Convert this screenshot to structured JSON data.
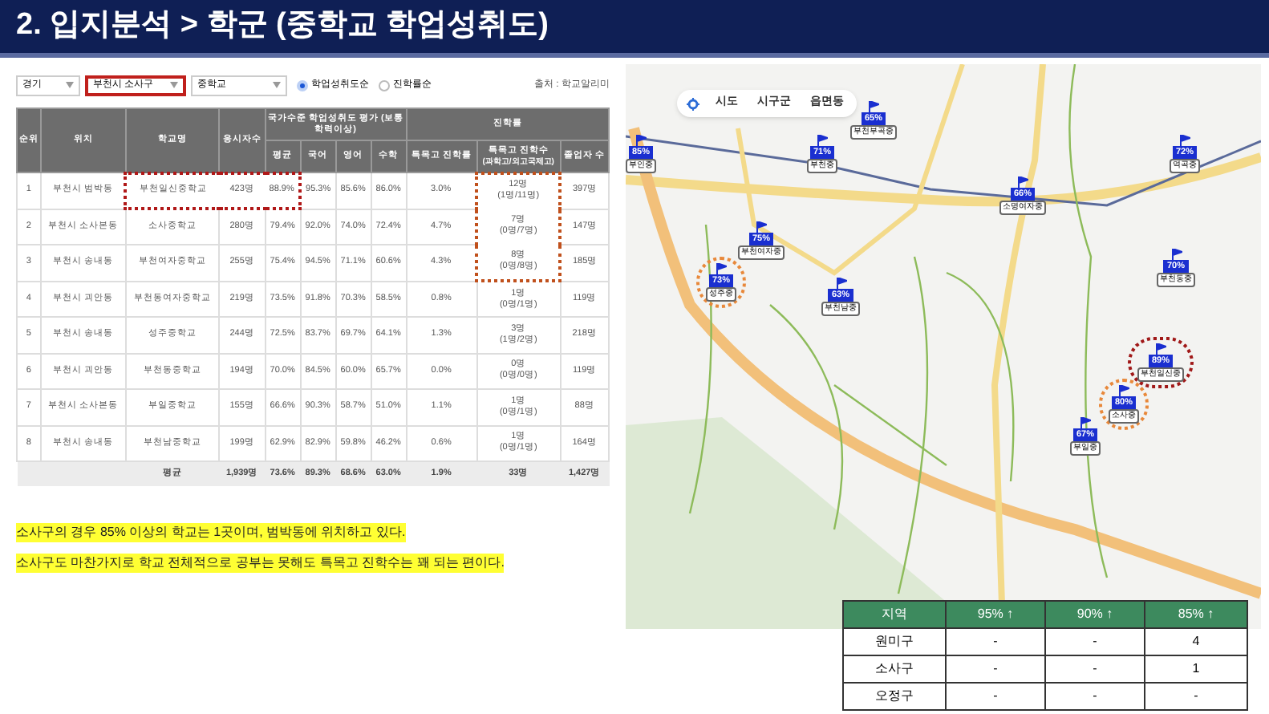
{
  "header": {
    "title": "2. 입지분석 > 학군 (중학교 학업성취도)"
  },
  "filters": {
    "selects": [
      {
        "value": "경기",
        "highlighted": false
      },
      {
        "value": "부천시 소사구",
        "highlighted": true
      },
      {
        "value": "중학교",
        "highlighted": false
      }
    ],
    "sort_options": [
      {
        "label": "학업성취도순",
        "selected": true
      },
      {
        "label": "진학률순",
        "selected": false
      }
    ],
    "source": "출처 : 학교알리미"
  },
  "table": {
    "columns": [
      "순위",
      "위치",
      "학교명",
      "응시자수"
    ],
    "group_1": {
      "title": "국가수준 학업성취도 평가 (보통학력이상)",
      "columns": [
        "평균",
        "국어",
        "영어",
        "수학"
      ]
    },
    "group_2": {
      "title": "진학률",
      "columns": [
        {
          "title": "특목고 진학률"
        },
        {
          "title": "특목고 진학수",
          "subtitle": "(과학고/외고국제고)"
        },
        {
          "title": "졸업자 수"
        }
      ]
    },
    "rows": [
      {
        "rank": "1",
        "location": "부천시 범박동",
        "school": "부천일신중학교",
        "takers": "423명",
        "avg": "88.9%",
        "korean": "95.3%",
        "english": "85.6%",
        "math": "86.0%",
        "rate": "3.0%",
        "count": "12명",
        "count_detail": "(1명/11명)",
        "graduates": "397명",
        "school_highlighted": true,
        "count_highlighted": true
      },
      {
        "rank": "2",
        "location": "부천시 소사본동",
        "school": "소사중학교",
        "takers": "280명",
        "avg": "79.4%",
        "korean": "92.0%",
        "english": "74.0%",
        "math": "72.4%",
        "rate": "4.7%",
        "count": "7명",
        "count_detail": "(0명/7명)",
        "graduates": "147명",
        "school_highlighted": false,
        "count_highlighted": true
      },
      {
        "rank": "3",
        "location": "부천시 송내동",
        "school": "부천여자중학교",
        "takers": "255명",
        "avg": "75.4%",
        "korean": "94.5%",
        "english": "71.1%",
        "math": "60.6%",
        "rate": "4.3%",
        "count": "8명",
        "count_detail": "(0명/8명)",
        "graduates": "185명",
        "school_highlighted": false,
        "count_highlighted": true
      },
      {
        "rank": "4",
        "location": "부천시 괴안동",
        "school": "부천동여자중학교",
        "takers": "219명",
        "avg": "73.5%",
        "korean": "91.8%",
        "english": "70.3%",
        "math": "58.5%",
        "rate": "0.8%",
        "count": "1명",
        "count_detail": "(0명/1명)",
        "graduates": "119명",
        "school_highlighted": false,
        "count_highlighted": false
      },
      {
        "rank": "5",
        "location": "부천시 송내동",
        "school": "성주중학교",
        "takers": "244명",
        "avg": "72.5%",
        "korean": "83.7%",
        "english": "69.7%",
        "math": "64.1%",
        "rate": "1.3%",
        "count": "3명",
        "count_detail": "(1명/2명)",
        "graduates": "218명",
        "school_highlighted": false,
        "count_highlighted": false
      },
      {
        "rank": "6",
        "location": "부천시 괴안동",
        "school": "부천동중학교",
        "takers": "194명",
        "avg": "70.0%",
        "korean": "84.5%",
        "english": "60.0%",
        "math": "65.7%",
        "rate": "0.0%",
        "count": "0명",
        "count_detail": "(0명/0명)",
        "graduates": "119명",
        "school_highlighted": false,
        "count_highlighted": false
      },
      {
        "rank": "7",
        "location": "부천시 소사본동",
        "school": "부일중학교",
        "takers": "155명",
        "avg": "66.6%",
        "korean": "90.3%",
        "english": "58.7%",
        "math": "51.0%",
        "rate": "1.1%",
        "count": "1명",
        "count_detail": "(0명/1명)",
        "graduates": "88명",
        "school_highlighted": false,
        "count_highlighted": false
      },
      {
        "rank": "8",
        "location": "부천시 송내동",
        "school": "부천남중학교",
        "takers": "199명",
        "avg": "62.9%",
        "korean": "82.9%",
        "english": "59.8%",
        "math": "46.2%",
        "rate": "0.6%",
        "count": "1명",
        "count_detail": "(0명/1명)",
        "graduates": "164명",
        "school_highlighted": false,
        "count_highlighted": false
      }
    ],
    "summary": {
      "label": "평균",
      "takers": "1,939명",
      "avg": "73.6%",
      "korean": "89.3%",
      "english": "68.6%",
      "math": "63.0%",
      "rate": "1.9%",
      "count": "33명",
      "graduates": "1,427명"
    }
  },
  "notes": [
    "소사구의 경우 85% 이상의 학교는 1곳이며, 범박동에 위치하고 있다.",
    "소사구도 마찬가지로 학교 전체적으로 공부는 못해도 특목고 진학수는 꽤 되는 편이다."
  ],
  "map": {
    "level_buttons": [
      "시도",
      "시구군",
      "읍면동"
    ],
    "markers": [
      {
        "percent": "85%",
        "name": "부인중",
        "circled": false
      },
      {
        "percent": "65%",
        "name": "부천부곡중",
        "circled": false
      },
      {
        "percent": "71%",
        "name": "부천중",
        "circled": false
      },
      {
        "percent": "66%",
        "name": "소명여자중",
        "circled": false
      },
      {
        "percent": "72%",
        "name": "역곡중",
        "circled": false
      },
      {
        "percent": "70%",
        "name": "부천동중",
        "circled": false
      },
      {
        "percent": "73%",
        "name": "성주중",
        "circled": true,
        "color": "#e8883a"
      },
      {
        "percent": "75%",
        "name": "부천여자중",
        "circled": false
      },
      {
        "percent": "63%",
        "name": "부천남중",
        "circled": false
      },
      {
        "percent": "89%",
        "name": "부천일신중",
        "circled": true,
        "color": "#a01818"
      },
      {
        "percent": "80%",
        "name": "소사중",
        "circled": true,
        "color": "#e8883a"
      },
      {
        "percent": "67%",
        "name": "부일중",
        "circled": false
      }
    ]
  },
  "summary_table": {
    "columns": [
      "지역",
      "95% ↑",
      "90% ↑",
      "85% ↑"
    ],
    "rows": [
      [
        "원미구",
        "-",
        "-",
        "4"
      ],
      [
        "소사구",
        "-",
        "-",
        "1"
      ],
      [
        "오정구",
        "-",
        "-",
        "-"
      ]
    ]
  }
}
